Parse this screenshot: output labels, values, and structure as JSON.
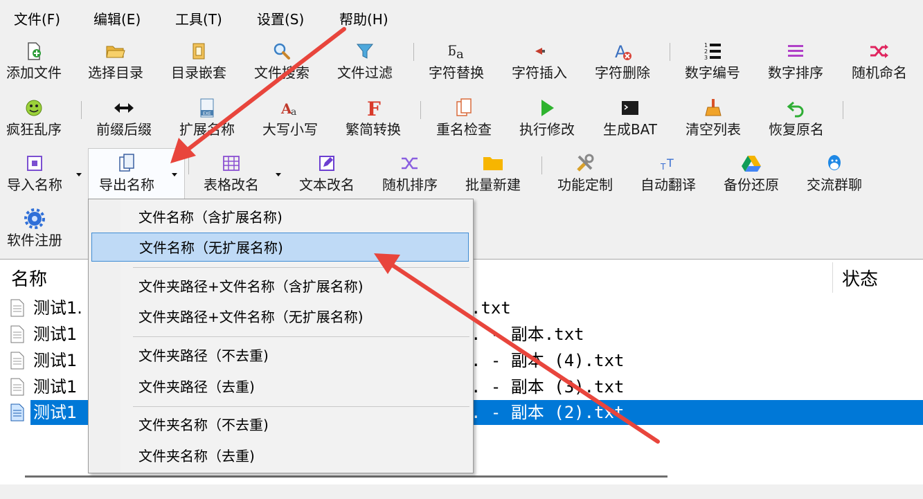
{
  "menubar": {
    "items": [
      {
        "label": "文件(F)"
      },
      {
        "label": "编辑(E)"
      },
      {
        "label": "工具(T)"
      },
      {
        "label": "设置(S)"
      },
      {
        "label": "帮助(H)"
      }
    ]
  },
  "toolbar": {
    "row1": [
      {
        "label": "添加文件",
        "icon": "add-file-icon"
      },
      {
        "label": "选择目录",
        "icon": "folder-open-icon"
      },
      {
        "label": "目录嵌套",
        "icon": "nested-folder-icon"
      },
      {
        "label": "文件搜索",
        "icon": "search-icon"
      },
      {
        "label": "文件过滤",
        "icon": "filter-icon"
      },
      {
        "label": "字符替换",
        "icon": "replace-text-icon"
      },
      {
        "label": "字符插入",
        "icon": "insert-char-icon"
      },
      {
        "label": "字符删除",
        "icon": "delete-char-icon"
      },
      {
        "label": "数字编号",
        "icon": "numbered-list-icon"
      },
      {
        "label": "数字排序",
        "icon": "sort-lines-icon"
      },
      {
        "label": "随机命名",
        "icon": "shuffle-icon"
      }
    ],
    "row2": [
      {
        "label": "疯狂乱序",
        "icon": "crazy-face-icon"
      },
      {
        "label": "前缀后缀",
        "icon": "left-right-arrows-icon"
      },
      {
        "label": "扩展名称",
        "icon": "extension-file-icon"
      },
      {
        "label": "大写小写",
        "icon": "letter-case-icon"
      },
      {
        "label": "繁简转换",
        "icon": "traditional-simplified-icon"
      },
      {
        "label": "重名检查",
        "icon": "duplicate-check-icon"
      },
      {
        "label": "执行修改",
        "icon": "play-icon"
      },
      {
        "label": "生成BAT",
        "icon": "terminal-icon"
      },
      {
        "label": "清空列表",
        "icon": "broom-icon"
      },
      {
        "label": "恢复原名",
        "icon": "undo-arrow-icon"
      }
    ],
    "row3": [
      {
        "label": "导入名称",
        "icon": "import-icon"
      },
      {
        "label": "导出名称",
        "icon": "export-icon"
      },
      {
        "label": "表格改名",
        "icon": "table-grid-icon"
      },
      {
        "label": "文本改名",
        "icon": "edit-text-icon"
      },
      {
        "label": "随机排序",
        "icon": "random-sort-icon"
      },
      {
        "label": "批量新建",
        "icon": "new-folder-icon"
      },
      {
        "label": "功能定制",
        "icon": "tools-icon"
      },
      {
        "label": "自动翻译",
        "icon": "translate-icon"
      },
      {
        "label": "备份还原",
        "icon": "drive-icon"
      },
      {
        "label": "交流群聊",
        "icon": "chat-penguin-icon"
      }
    ],
    "row4": [
      {
        "label": "软件注册",
        "icon": "gear-icon"
      }
    ]
  },
  "filelist": {
    "col_name": "名称",
    "col_status": "状态",
    "rows": [
      {
        "name": "测试1.",
        "rest": ".txt"
      },
      {
        "name": "测试1",
        "rest": ". - 副本.txt"
      },
      {
        "name": "测试1",
        "rest": ". - 副本 (4).txt"
      },
      {
        "name": "测试1",
        "rest": ". - 副本 (3).txt"
      },
      {
        "name": "测试1",
        "rest": ". - 副本 (2).txt"
      }
    ],
    "selected_row": 4
  },
  "export_menu": {
    "items": [
      "文件名称（含扩展名称)",
      "文件名称（无扩展名称)",
      "文件夹路径+文件名称（含扩展名称)",
      "文件夹路径+文件名称（无扩展名称)",
      "文件夹路径（不去重)",
      "文件夹路径（去重)",
      "文件夹名称（不去重)",
      "文件夹名称（去重)"
    ],
    "highlighted": 1
  },
  "colors": {
    "selection": "#0078d7",
    "menu_highlight": "#bfdaf6",
    "annotation_arrow": "#e8453c"
  }
}
